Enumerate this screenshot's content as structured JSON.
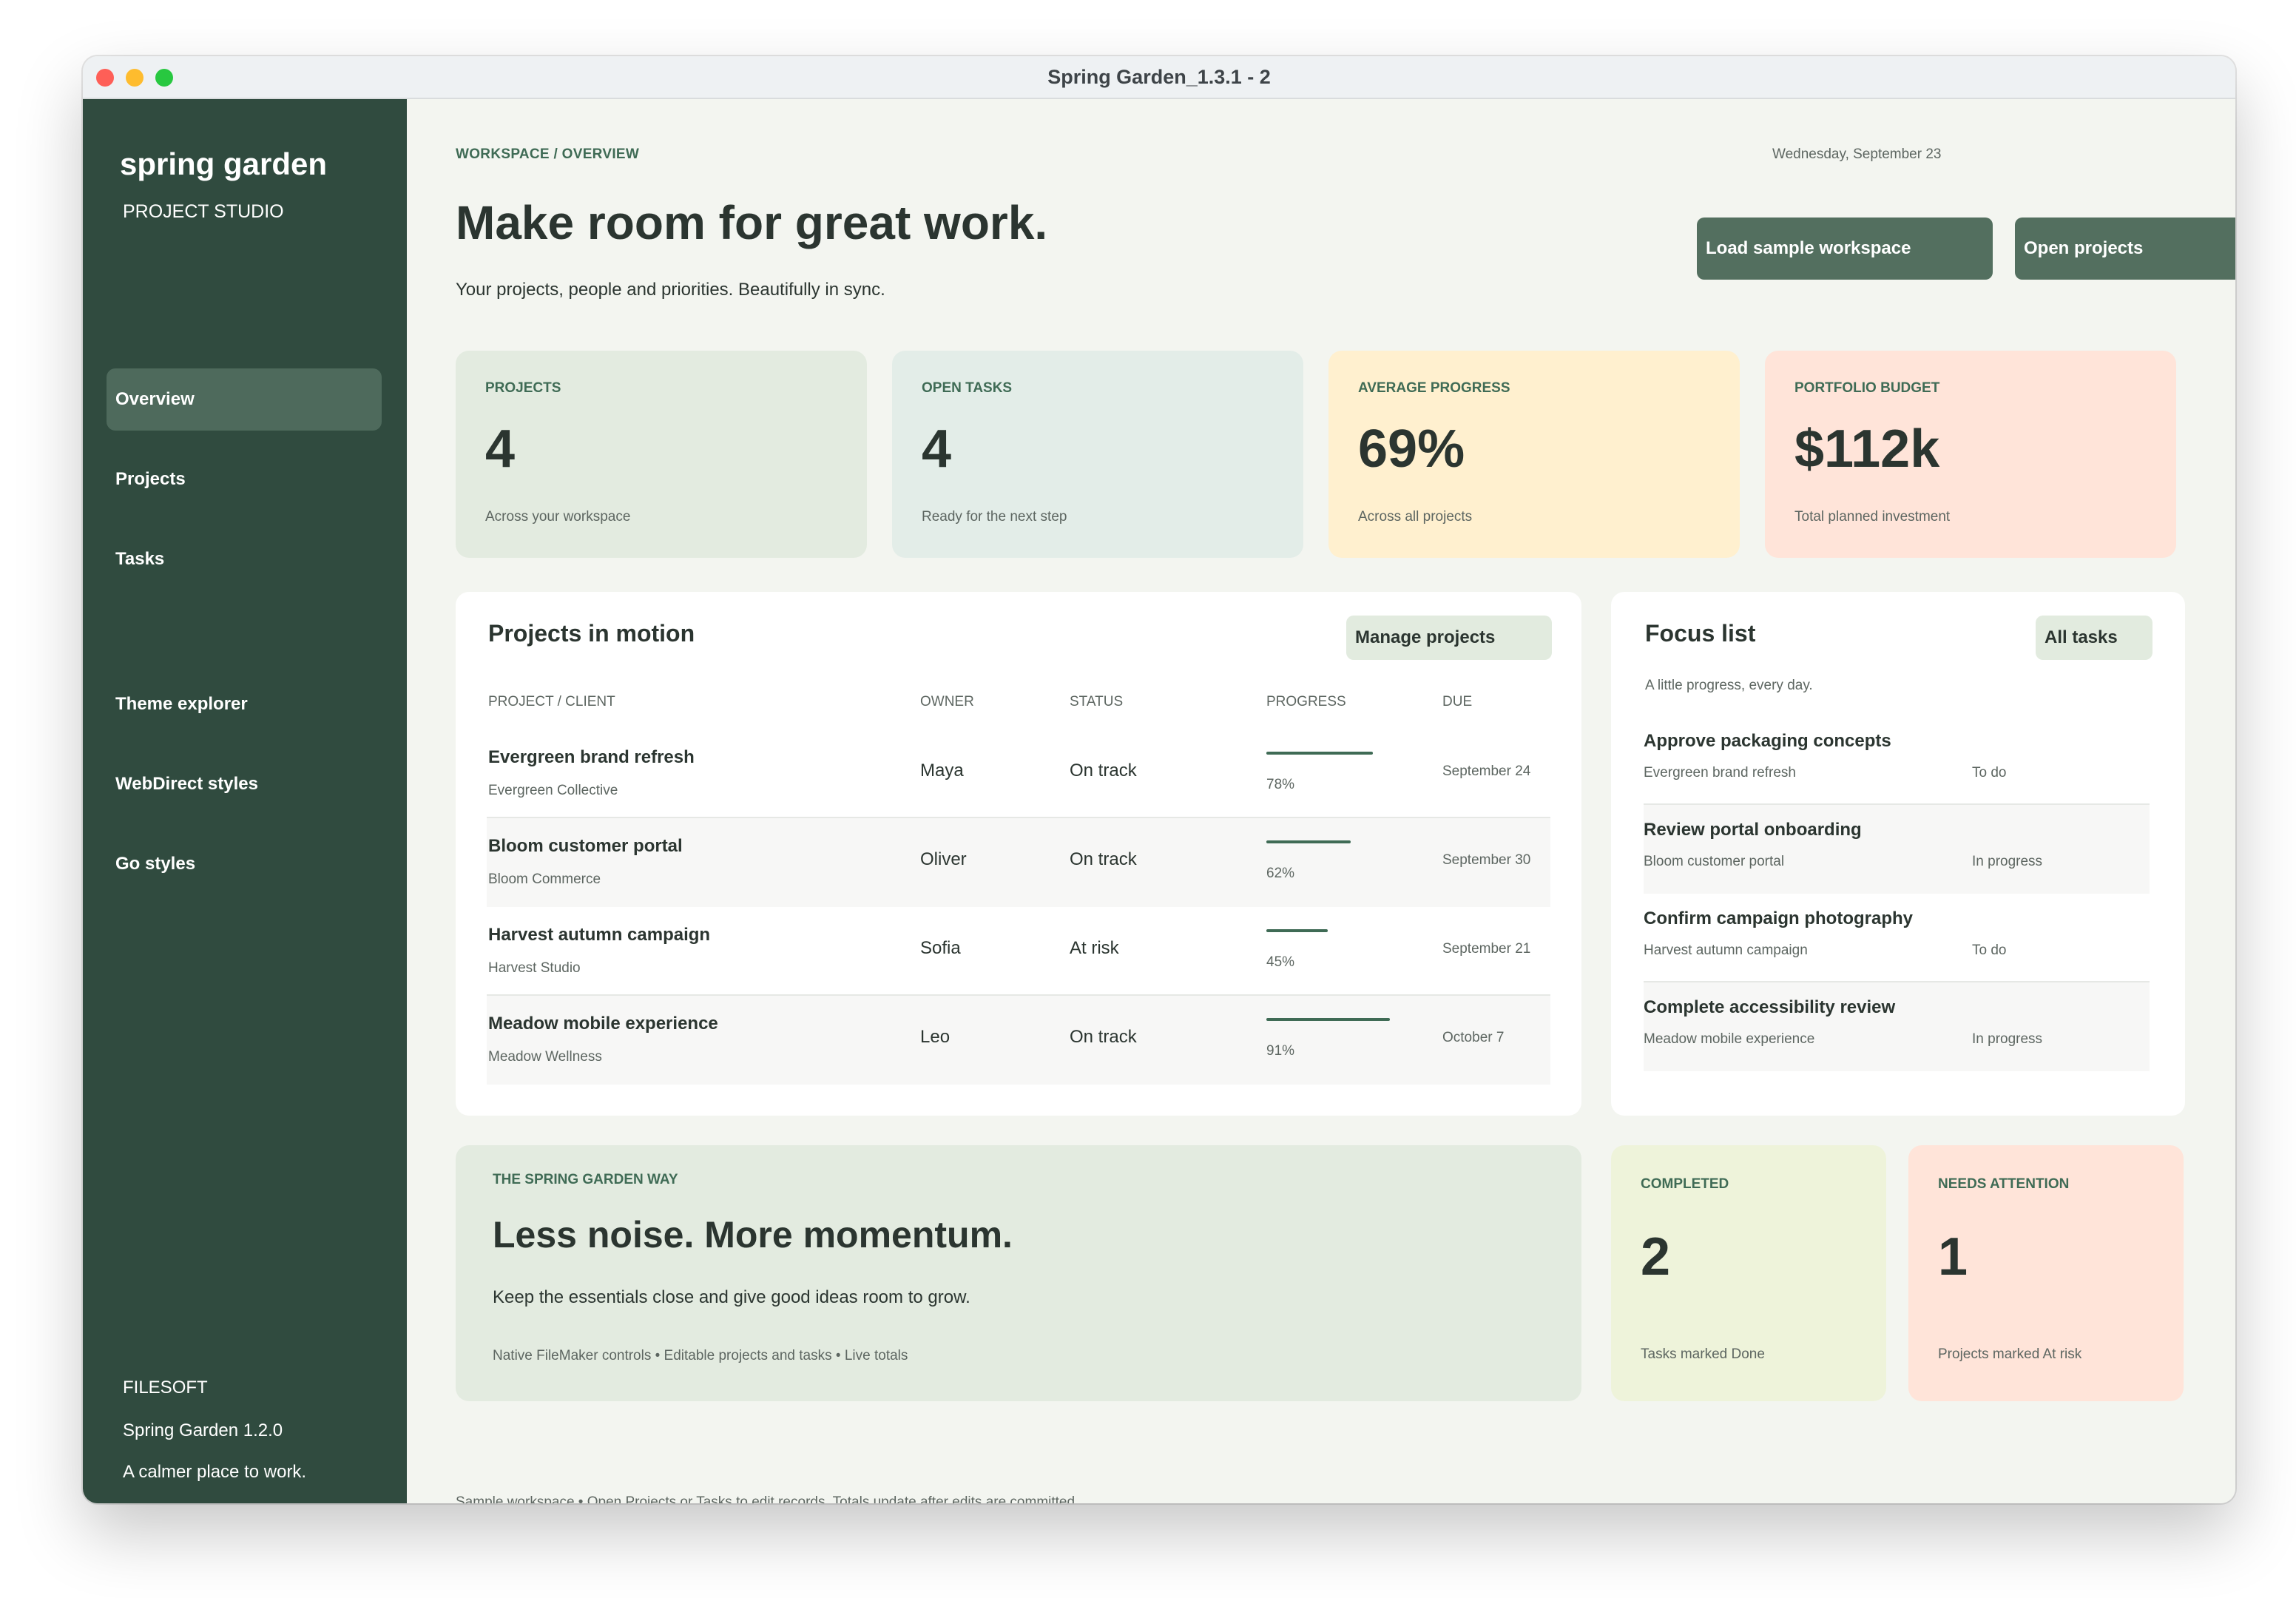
{
  "window": {
    "title": "Spring Garden_1.3.1 - 2"
  },
  "sidebar": {
    "brand": "spring garden",
    "subtitle": "PROJECT STUDIO",
    "nav": [
      {
        "label": "Overview",
        "active": true
      },
      {
        "label": "Projects"
      },
      {
        "label": "Tasks"
      }
    ],
    "secondary_nav": [
      {
        "label": "Theme explorer"
      },
      {
        "label": "WebDirect styles"
      },
      {
        "label": "Go styles"
      }
    ],
    "footer": {
      "company": "FILESOFT",
      "version": "Spring Garden 1.2.0",
      "tagline": "A calmer place to work."
    }
  },
  "header": {
    "breadcrumb": "WORKSPACE / OVERVIEW",
    "date": "Wednesday, September 23",
    "title": "Make room for great work.",
    "subtitle": "Your projects, people and priorities. Beautifully in sync.",
    "buttons": {
      "load_sample": "Load sample workspace",
      "open_projects": "Open projects"
    }
  },
  "stats": [
    {
      "label": "PROJECTS",
      "value": "4",
      "note": "Across your workspace",
      "color": "#e3ebe0"
    },
    {
      "label": "OPEN TASKS",
      "value": "4",
      "note": "Ready for the next step",
      "color": "#e3ede8"
    },
    {
      "label": "AVERAGE PROGRESS",
      "value": "69%",
      "note": "Across all projects",
      "color": "#fff0cf"
    },
    {
      "label": "PORTFOLIO BUDGET",
      "value": "$112k",
      "note": "Total planned investment",
      "color": "#ffe4d9"
    }
  ],
  "projects": {
    "title": "Projects in motion",
    "manage_button": "Manage projects",
    "columns": [
      "PROJECT / CLIENT",
      "OWNER",
      "STATUS",
      "PROGRESS",
      "DUE"
    ],
    "rows": [
      {
        "name": "Evergreen brand refresh",
        "client": "Evergreen Collective",
        "owner": "Maya",
        "status": "On track",
        "progress": 78,
        "progress_label": "78%",
        "due": "September 24"
      },
      {
        "name": "Bloom customer portal",
        "client": "Bloom Commerce",
        "owner": "Oliver",
        "status": "On track",
        "progress": 62,
        "progress_label": "62%",
        "due": "September 30"
      },
      {
        "name": "Harvest autumn campaign",
        "client": "Harvest Studio",
        "owner": "Sofia",
        "status": "At risk",
        "progress": 45,
        "progress_label": "45%",
        "due": "September 21"
      },
      {
        "name": "Meadow mobile experience",
        "client": "Meadow Wellness",
        "owner": "Leo",
        "status": "On track",
        "progress": 91,
        "progress_label": "91%",
        "due": "October 7"
      }
    ]
  },
  "focus": {
    "title": "Focus list",
    "all_tasks_button": "All tasks",
    "subtitle": "A little progress, every day.",
    "items": [
      {
        "title": "Approve packaging concepts",
        "project": "Evergreen brand refresh",
        "status": "To do"
      },
      {
        "title": "Review portal onboarding",
        "project": "Bloom customer portal",
        "status": "In progress"
      },
      {
        "title": "Confirm campaign photography",
        "project": "Harvest autumn campaign",
        "status": "To do"
      },
      {
        "title": "Complete accessibility review",
        "project": "Meadow mobile experience",
        "status": "In progress"
      }
    ]
  },
  "promo": {
    "eyebrow": "THE SPRING GARDEN WAY",
    "title": "Less noise. More momentum.",
    "body": "Keep the essentials close and give good ideas room to grow.",
    "features": "Native FileMaker controls • Editable projects and tasks • Live totals"
  },
  "mini_stats": [
    {
      "label": "COMPLETED",
      "value": "2",
      "note": "Tasks marked Done",
      "color": "#eef3da"
    },
    {
      "label": "NEEDS ATTENTION",
      "value": "1",
      "note": "Projects marked At risk",
      "color": "#ffe4d9"
    }
  ],
  "footnote": "Sample workspace • Open Projects or Tasks to edit records. Totals update after edits are committed.",
  "colors": {
    "sidebar": "#304b3f",
    "accent": "#536f5f",
    "background": "#f3f5f0"
  }
}
